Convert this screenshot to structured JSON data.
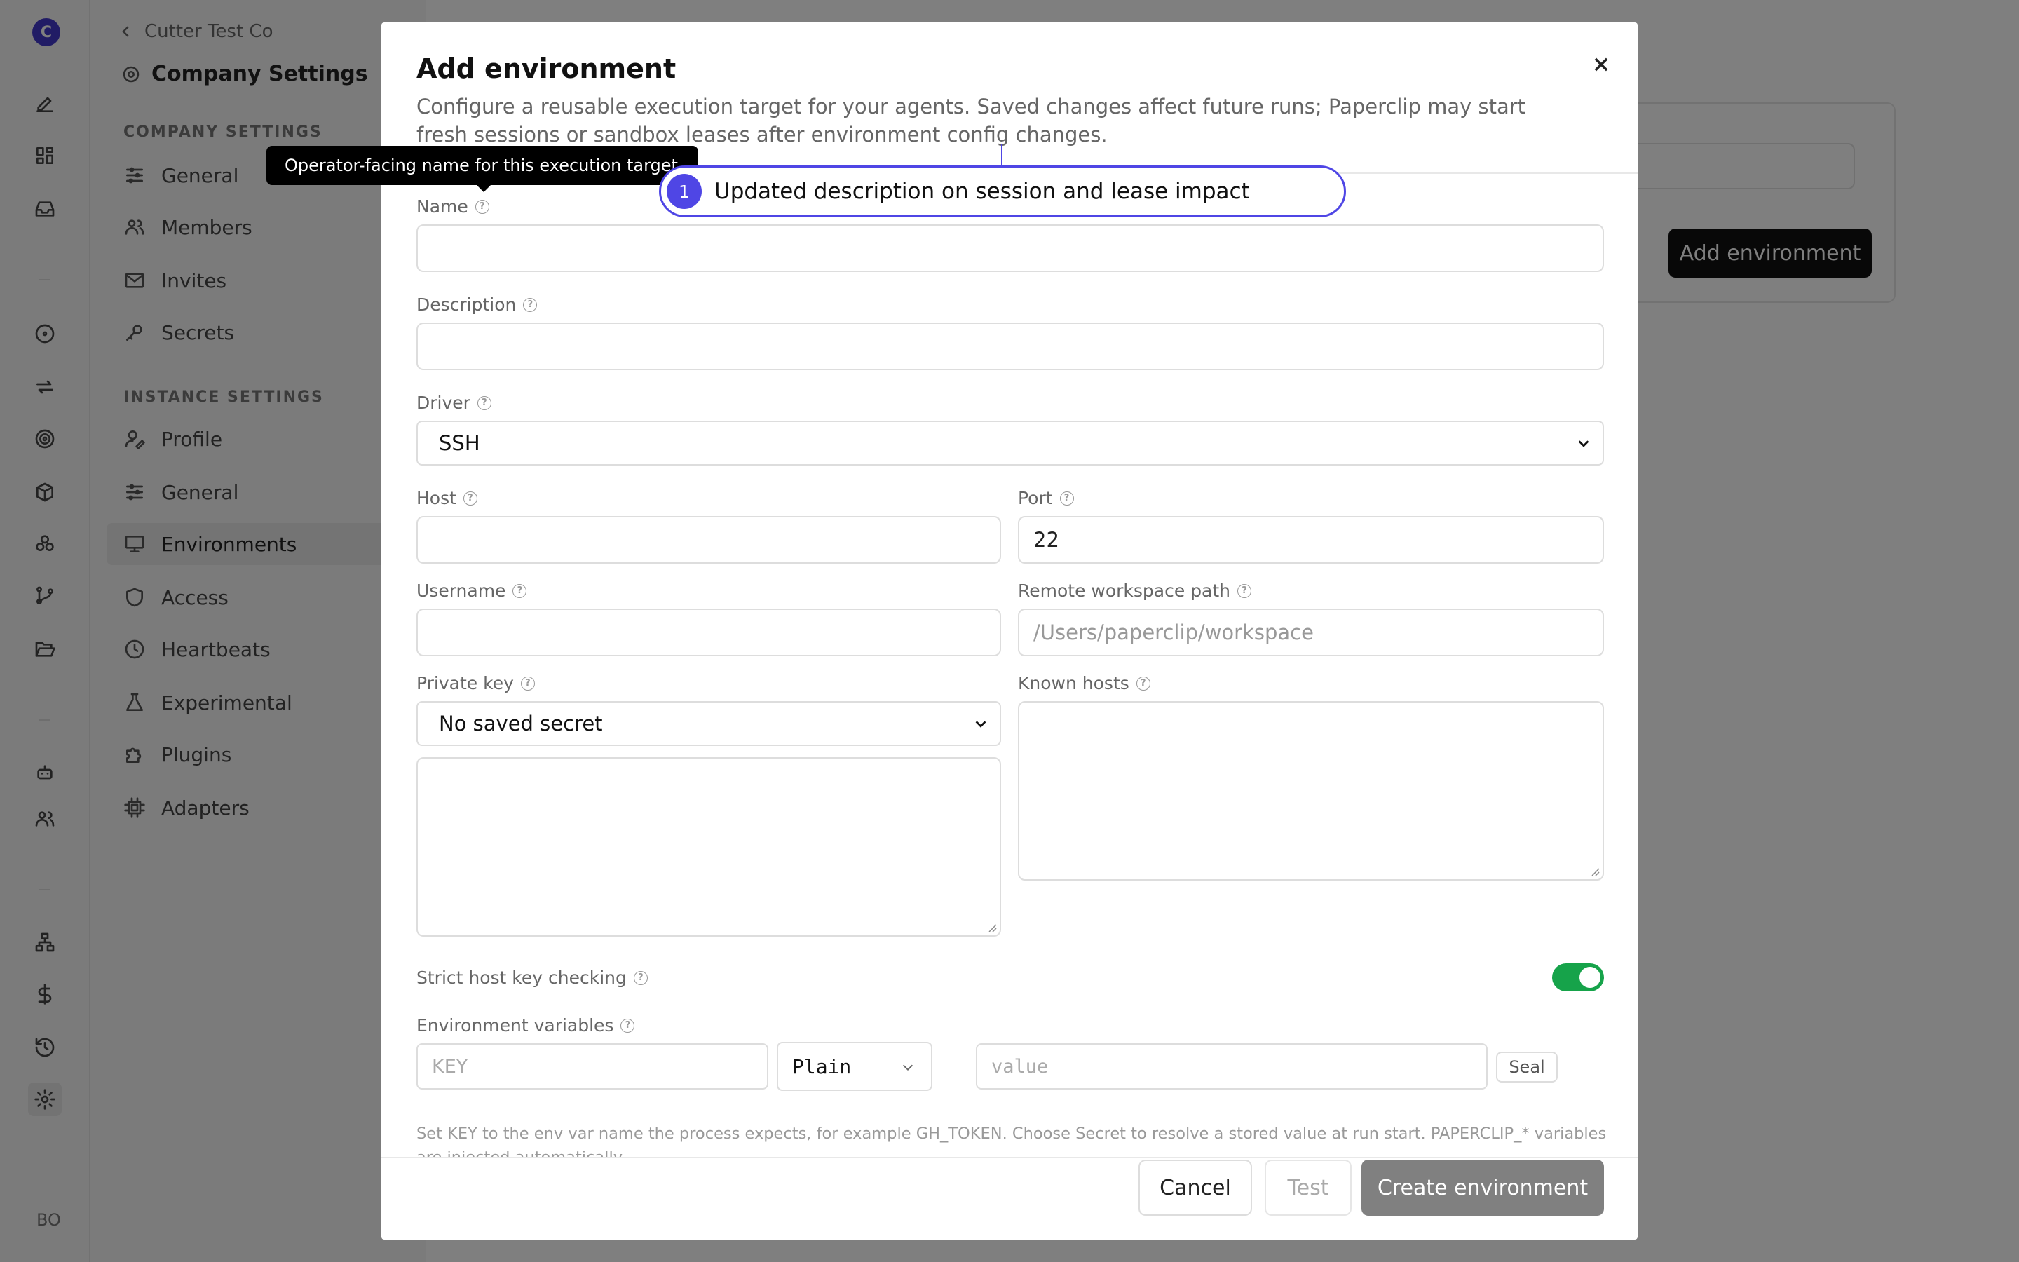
{
  "rail": {
    "logo_letter": "C",
    "user_initials": "BO"
  },
  "sidebar": {
    "back_label": "Cutter Test Co",
    "title": "Company Settings",
    "company_section": "COMPANY SETTINGS",
    "company_items": [
      {
        "label": "General",
        "icon": "sliders-icon"
      },
      {
        "label": "Members",
        "icon": "users-icon"
      },
      {
        "label": "Invites",
        "icon": "mail-plus-icon"
      },
      {
        "label": "Secrets",
        "icon": "key-icon"
      }
    ],
    "instance_section": "INSTANCE SETTINGS",
    "instance_items": [
      {
        "label": "Profile",
        "icon": "user-pen-icon"
      },
      {
        "label": "General",
        "icon": "sliders-icon"
      },
      {
        "label": "Environments",
        "icon": "monitor-cog-icon",
        "active": true
      },
      {
        "label": "Access",
        "icon": "shield-icon"
      },
      {
        "label": "Heartbeats",
        "icon": "clock-icon"
      },
      {
        "label": "Experimental",
        "icon": "flask-icon"
      },
      {
        "label": "Plugins",
        "icon": "puzzle-icon"
      },
      {
        "label": "Adapters",
        "icon": "cpu-icon"
      }
    ]
  },
  "background": {
    "add_environment_button": "Add environment"
  },
  "modal": {
    "title": "Add environment",
    "description": "Configure a reusable execution target for your agents. Saved changes affect future runs; Paperclip may start fresh sessions or sandbox leases after environment config changes.",
    "fields": {
      "name": {
        "label": "Name",
        "value": ""
      },
      "description": {
        "label": "Description",
        "value": ""
      },
      "driver": {
        "label": "Driver",
        "value": "SSH"
      },
      "host": {
        "label": "Host",
        "value": ""
      },
      "port": {
        "label": "Port",
        "value": "22"
      },
      "username": {
        "label": "Username",
        "value": ""
      },
      "remote_path": {
        "label": "Remote workspace path",
        "placeholder": "/Users/paperclip/workspace"
      },
      "private_key": {
        "label": "Private key",
        "value": "No saved secret"
      },
      "known_hosts": {
        "label": "Known hosts"
      },
      "strict_host_key": {
        "label": "Strict host key checking",
        "enabled": true
      },
      "env_vars": {
        "label": "Environment variables",
        "key_placeholder": "KEY",
        "type_value": "Plain",
        "value_placeholder": "value",
        "seal_label": "Seal",
        "hint": "Set KEY to the env var name the process expects, for example GH_TOKEN. Choose Secret to resolve a stored value at run start. PAPERCLIP_* variables are injected automatically."
      }
    },
    "buttons": {
      "cancel": "Cancel",
      "test": "Test",
      "create": "Create environment"
    }
  },
  "tooltip": {
    "text": "Operator-facing name for this execution target"
  },
  "annotation": {
    "number": "1",
    "text": "Updated description on session and lease impact",
    "color": "#4f46e5"
  },
  "colors": {
    "toggle_on": "#16a34a",
    "accent": "#4f46e5"
  }
}
